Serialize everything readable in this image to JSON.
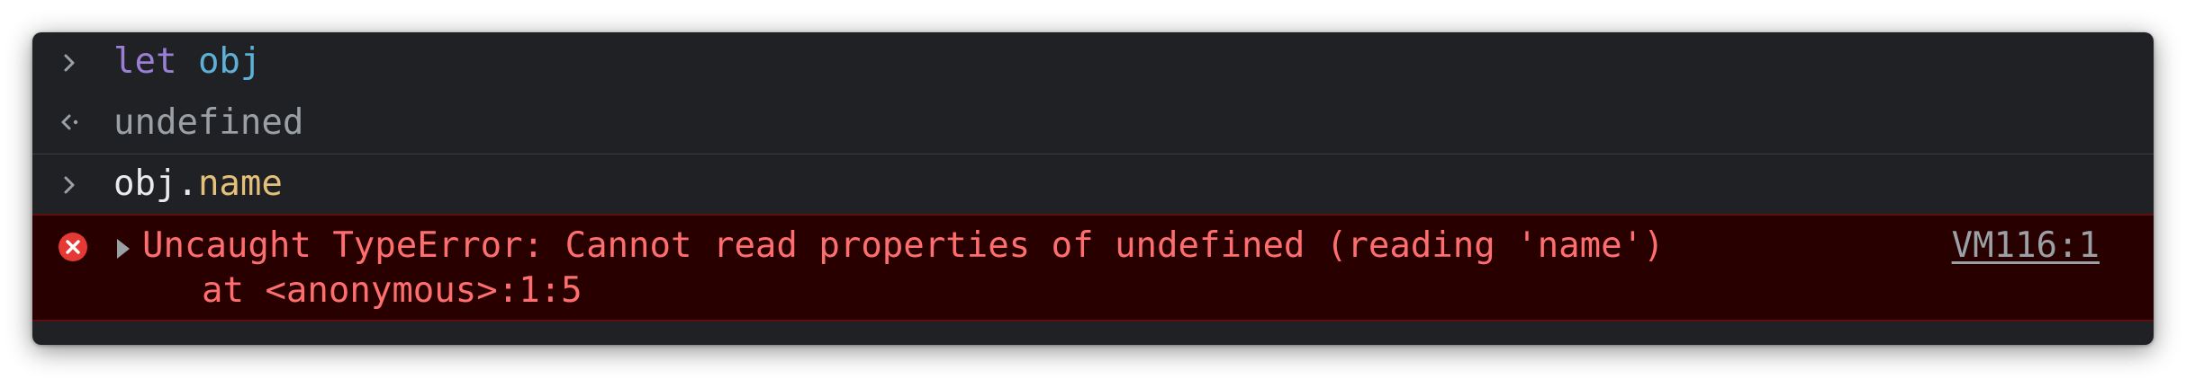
{
  "console": {
    "entries": [
      {
        "type": "input",
        "icon": "chevron-right-icon",
        "tokens": [
          "let",
          " ",
          "obj"
        ]
      },
      {
        "type": "result",
        "icon": "return-arrow-icon",
        "value": "undefined"
      },
      {
        "type": "input",
        "icon": "chevron-right-icon",
        "tokens": [
          "obj",
          ".",
          "name"
        ]
      },
      {
        "type": "error",
        "icon": "error-icon",
        "message": "Uncaught TypeError: Cannot read properties of undefined (reading 'name')",
        "stack": "at <anonymous>:1:5",
        "source": "VM116:1"
      }
    ]
  },
  "colors": {
    "background": "#202124",
    "keyword": "#9a7fd5",
    "variable": "#5db0d7",
    "property": "#e5c07b",
    "error_text": "#ff6e6e",
    "error_background": "#290000",
    "error_icon": "#e53935",
    "muted": "#9aa0a6"
  }
}
